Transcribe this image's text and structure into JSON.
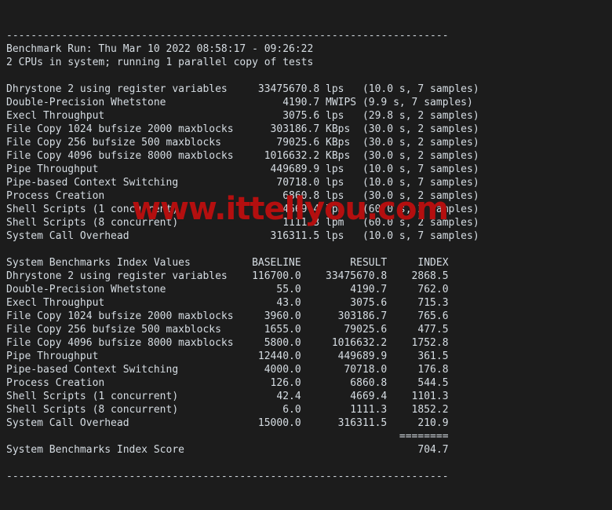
{
  "terminal": {
    "rule_top": "------------------------------------------------------------------------",
    "rule_bottom": "------------------------------------------------------------------------",
    "header_lines": [
      "Benchmark Run: Thu Mar 10 2022 08:58:17 - 09:26:22",
      "2 CPUs in system; running 1 parallel copy of tests"
    ],
    "results_header": {
      "baseline_label": "BASELINE",
      "result_label": "RESULT",
      "index_label": "INDEX",
      "section_label": "System Benchmarks Index Values"
    },
    "raw_results": [
      {
        "name": "Dhrystone 2 using register variables",
        "value": "33475670.8",
        "unit": "lps",
        "timing": "(10.0 s, 7 samples)"
      },
      {
        "name": "Double-Precision Whetstone",
        "value": "4190.7",
        "unit": "MWIPS",
        "timing": "(9.9 s, 7 samples)"
      },
      {
        "name": "Execl Throughput",
        "value": "3075.6",
        "unit": "lps",
        "timing": "(29.8 s, 2 samples)"
      },
      {
        "name": "File Copy 1024 bufsize 2000 maxblocks",
        "value": "303186.7",
        "unit": "KBps",
        "timing": "(30.0 s, 2 samples)"
      },
      {
        "name": "File Copy 256 bufsize 500 maxblocks",
        "value": "79025.6",
        "unit": "KBps",
        "timing": "(30.0 s, 2 samples)"
      },
      {
        "name": "File Copy 4096 bufsize 8000 maxblocks",
        "value": "1016632.2",
        "unit": "KBps",
        "timing": "(30.0 s, 2 samples)"
      },
      {
        "name": "Pipe Throughput",
        "value": "449689.9",
        "unit": "lps",
        "timing": "(10.0 s, 7 samples)"
      },
      {
        "name": "Pipe-based Context Switching",
        "value": "70718.0",
        "unit": "lps",
        "timing": "(10.0 s, 7 samples)"
      },
      {
        "name": "Process Creation",
        "value": "6860.8",
        "unit": "lps",
        "timing": "(30.0 s, 2 samples)"
      },
      {
        "name": "Shell Scripts (1 concurrent)",
        "value": "4669.4",
        "unit": "lpm",
        "timing": "(60.0 s, 2 samples)"
      },
      {
        "name": "Shell Scripts (8 concurrent)",
        "value": "1111.3",
        "unit": "lpm",
        "timing": "(60.0 s, 2 samples)"
      },
      {
        "name": "System Call Overhead",
        "value": "316311.5",
        "unit": "lps",
        "timing": "(10.0 s, 7 samples)"
      }
    ],
    "index_values": [
      {
        "name": "Dhrystone 2 using register variables",
        "baseline": "116700.0",
        "result": "33475670.8",
        "index": "2868.5"
      },
      {
        "name": "Double-Precision Whetstone",
        "baseline": "55.0",
        "result": "4190.7",
        "index": "762.0"
      },
      {
        "name": "Execl Throughput",
        "baseline": "43.0",
        "result": "3075.6",
        "index": "715.3"
      },
      {
        "name": "File Copy 1024 bufsize 2000 maxblocks",
        "baseline": "3960.0",
        "result": "303186.7",
        "index": "765.6"
      },
      {
        "name": "File Copy 256 bufsize 500 maxblocks",
        "baseline": "1655.0",
        "result": "79025.6",
        "index": "477.5"
      },
      {
        "name": "File Copy 4096 bufsize 8000 maxblocks",
        "baseline": "5800.0",
        "result": "1016632.2",
        "index": "1752.8"
      },
      {
        "name": "Pipe Throughput",
        "baseline": "12440.0",
        "result": "449689.9",
        "index": "361.5"
      },
      {
        "name": "Pipe-based Context Switching",
        "baseline": "4000.0",
        "result": "70718.0",
        "index": "176.8"
      },
      {
        "name": "Process Creation",
        "baseline": "126.0",
        "result": "6860.8",
        "index": "544.5"
      },
      {
        "name": "Shell Scripts (1 concurrent)",
        "baseline": "42.4",
        "result": "4669.4",
        "index": "1101.3"
      },
      {
        "name": "Shell Scripts (8 concurrent)",
        "baseline": "6.0",
        "result": "1111.3",
        "index": "1852.2"
      },
      {
        "name": "System Call Overhead",
        "baseline": "15000.0",
        "result": "316311.5",
        "index": "210.9"
      }
    ],
    "score_separator": "========",
    "score_label": "System Benchmarks Index Score",
    "score_value": "704.7"
  },
  "watermark": {
    "text": "www.ittellyou.com",
    "color": "#b40f0f"
  },
  "colors": {
    "background": "#1c1c1c",
    "foreground": "#d6dde3",
    "watermark": "#b40f0f"
  }
}
